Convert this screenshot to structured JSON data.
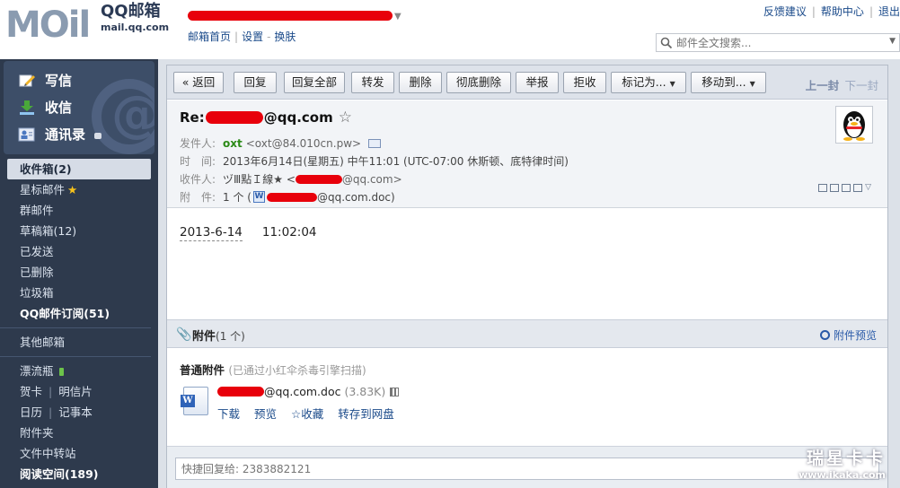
{
  "header": {
    "logo_text": "MOil",
    "brand_cn": "QQ邮箱",
    "brand_domain": "mail.qq.com",
    "nav_links": [
      "邮箱首页",
      "设置",
      "换肤"
    ],
    "right_links": [
      "反馈建议",
      "帮助中心",
      "退出"
    ],
    "search_placeholder": "邮件全文搜索..."
  },
  "sidebar": {
    "actions": [
      {
        "label": "写信",
        "icon": "write-icon"
      },
      {
        "label": "收信",
        "icon": "receive-icon"
      },
      {
        "label": "通讯录",
        "icon": "contacts-icon"
      }
    ],
    "folders": [
      {
        "label": "收件箱(2)",
        "active": true
      },
      {
        "label": "星标邮件",
        "star": true
      },
      {
        "label": "群邮件"
      },
      {
        "label": "草稿箱(12)"
      },
      {
        "label": "已发送"
      },
      {
        "label": "已删除"
      },
      {
        "label": "垃圾箱"
      },
      {
        "label": "QQ邮件订阅(51)",
        "bold": true
      }
    ],
    "other_mail": "其他邮箱",
    "drift_bottle": "漂流瓶",
    "greeting_card": "贺卡",
    "postcard": "明信片",
    "calendar": "日历",
    "notebook": "记事本",
    "attachments": "附件夹",
    "file_transfer": "文件中转站",
    "reading_space": "阅读空间(189)"
  },
  "toolbar": {
    "back": "« 返回",
    "reply": "回复",
    "reply_all": "回复全部",
    "forward": "转发",
    "delete": "删除",
    "delete_permanent": "彻底删除",
    "report": "举报",
    "reject": "拒收",
    "mark_as": "标记为...",
    "move_to": "移动到...",
    "prev": "上一封",
    "next": "下一封"
  },
  "message": {
    "subject_prefix": "Re:",
    "subject_suffix": "@qq.com",
    "from_label": "发件人:",
    "from_name": "oxt",
    "from_addr": "<oxt@84.010cn.pw>",
    "time_label": "时　间:",
    "time_value": "2013年6月14日(星期五) 中午11:01 (UTC-07:00 休斯顿、底特律时间)",
    "to_label": "收件人:",
    "to_name": "ヅⅢ點Ｉ線★ <",
    "to_addr_suffix": "@qq.com>",
    "att_label": "附　件:",
    "att_count_open": "1 个 (",
    "att_name_suffix": "@qq.com.doc)",
    "body_date": "2013-6-14",
    "body_time": "11:02:04"
  },
  "attachments": {
    "title": "附件",
    "count": "(1 个)",
    "preview_link": "附件预览",
    "group_title": "普通附件",
    "scan_note": "(已通过小红伞杀毒引擎扫描)",
    "file_suffix": "@qq.com.doc",
    "file_size": "(3.83K)",
    "actions": [
      "下载",
      "预览",
      "☆收藏",
      "转存到网盘"
    ]
  },
  "quick_reply": {
    "placeholder": "快捷回复给: 2383882121"
  },
  "watermark": {
    "line1": "瑞星卡卡",
    "line2": "www.ikaka.com"
  }
}
